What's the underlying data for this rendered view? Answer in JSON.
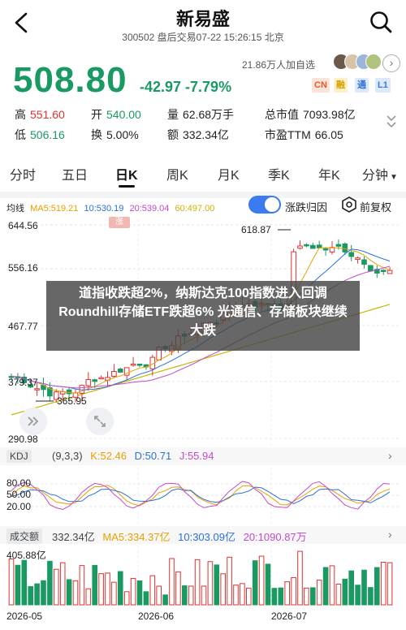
{
  "header": {
    "title": "新易盛",
    "subtitle": "300502 盘后交易07-22 15:26:15 北京"
  },
  "quote": {
    "price": "508.80",
    "change": "-42.97 -7.79%",
    "watchers": "21.86万人加自选",
    "badges": [
      "CN",
      "融",
      "通",
      "L1"
    ]
  },
  "stats": {
    "high_label": "高",
    "high": "551.60",
    "open_label": "开",
    "open": "540.00",
    "volume_label": "量",
    "volume": "62.68万手",
    "mktcap_label": "总市值",
    "mktcap": "7093.98亿",
    "low_label": "低",
    "low": "506.16",
    "turnover_label": "换",
    "turnover": "5.00%",
    "amount_label": "额",
    "amount": "332.34亿",
    "pe_label": "市盈TTM",
    "pe": "66.05"
  },
  "tabs": [
    "分时",
    "五日",
    "日K",
    "周K",
    "月K",
    "季K",
    "年K",
    "分钟"
  ],
  "active_tab": "日K",
  "ma": {
    "label": "均线",
    "ma5": "MA5:519.21",
    "ma10": "10:530.19",
    "ma20": "20:539.04",
    "ma60": "60:497.00",
    "toggle_label": "涨跌归因",
    "qfq_label": "前复权"
  },
  "chart": {
    "y_labels": [
      "644.56",
      "556.16",
      "467.77",
      "379.37",
      "290.98"
    ],
    "rise_tag": "涨",
    "high_marker": "618.87",
    "low_marker": "365.95",
    "x_labels": [
      "2026-05",
      "2026-06",
      "2026-07"
    ]
  },
  "kdj": {
    "name": "KDJ",
    "params": "(9,3,3)",
    "k": "K:52.46",
    "d": "D:50.71",
    "j": "J:55.94",
    "y_labels": [
      "80.00",
      "50.00",
      "20.00"
    ]
  },
  "volume": {
    "name": "成交额",
    "value": "332.34亿",
    "ma5": "MA5:334.37亿",
    "ma10": "10:303.09亿",
    "ma20": "20:1090.87万",
    "y_label": "405.88亿"
  },
  "news": {
    "headline": "道指收跌超2%，纳斯达克100指数进入回调 Roundhill存储ETF跌超6% 光通信、存储板块继续大跌"
  },
  "colors": {
    "up": "#e0322f",
    "down": "#1a9a63",
    "ma5": "#e8a000",
    "ma10": "#2a72d8",
    "ma20": "#c24bc9",
    "ma60": "#c9b400",
    "accent": "#3a7bf0"
  }
}
